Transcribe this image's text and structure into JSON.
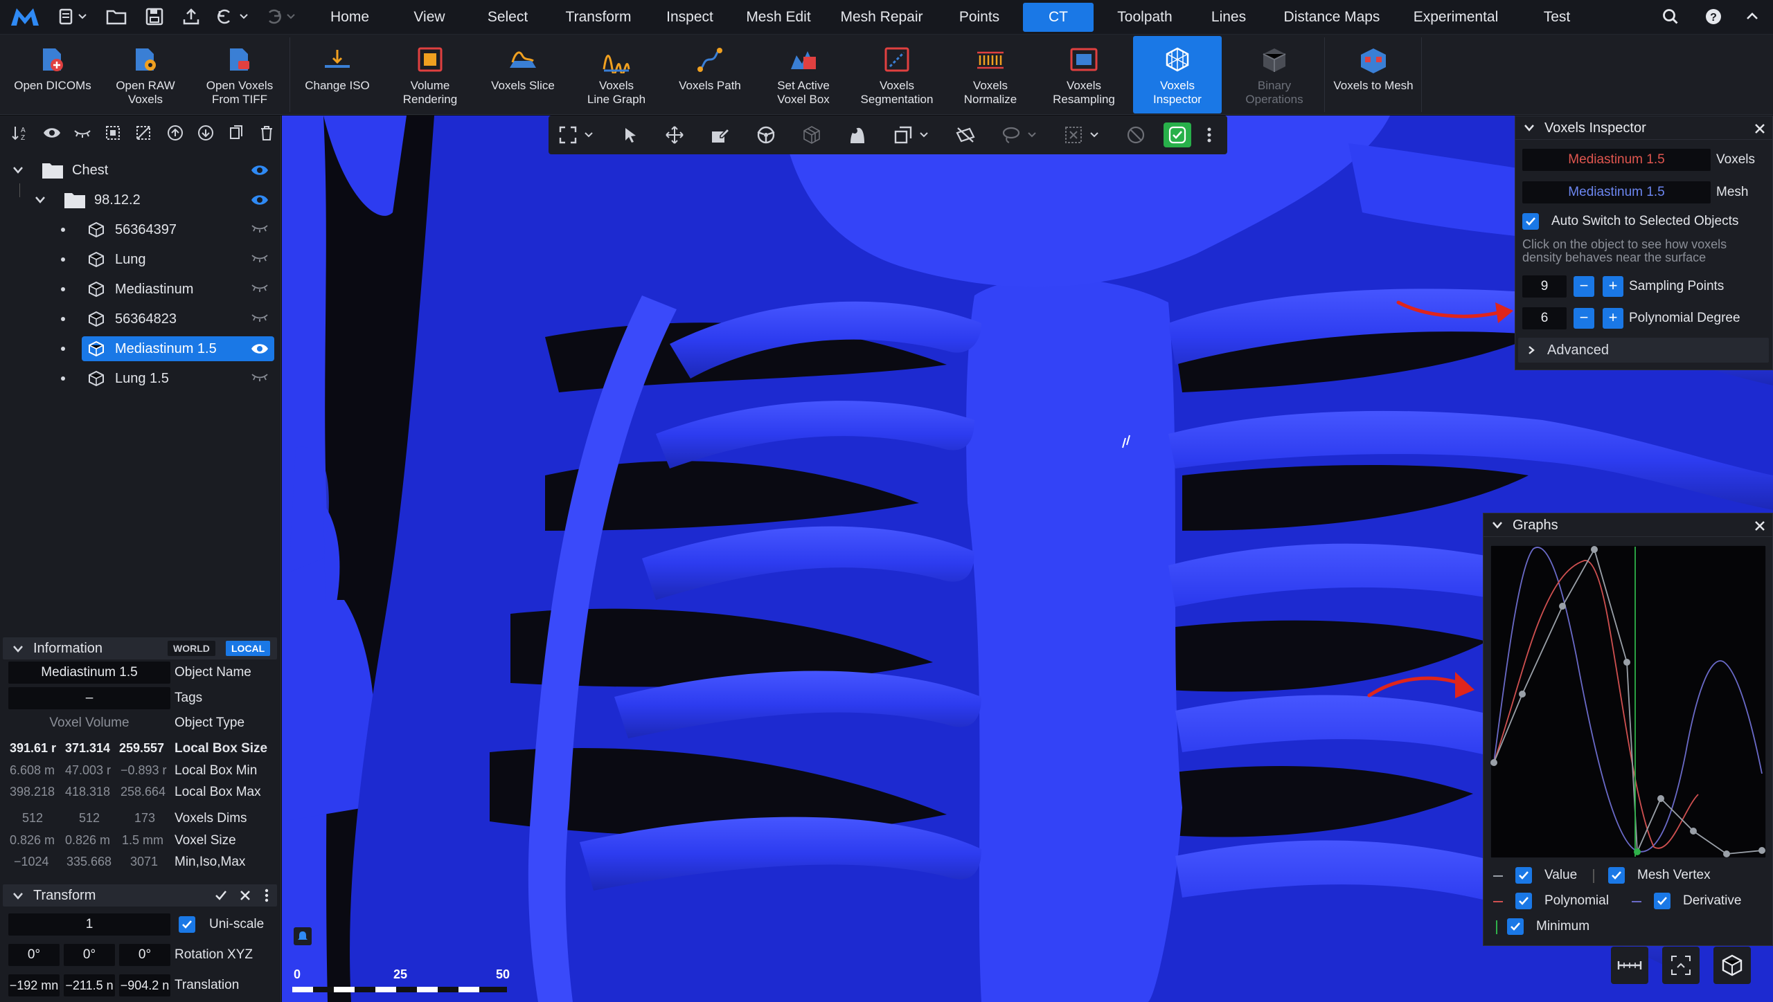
{
  "colors": {
    "accent": "#1a78e6",
    "mesh": "#2d3cf0",
    "highlight_text": "#e0564f",
    "arrow": "#e0251b",
    "value_curve": "#9aa0a8",
    "polynomial_curve": "#d05050",
    "derivative_curve": "#6a6ac8",
    "minimum_line": "#2fb14a"
  },
  "menu": {
    "items": [
      "Home",
      "View",
      "Select",
      "Transform",
      "Inspect",
      "Mesh Edit",
      "Mesh Repair",
      "Points",
      "CT",
      "Toolpath",
      "Lines",
      "Distance Maps",
      "Experimental",
      "Test"
    ],
    "active": "CT"
  },
  "ribbon": {
    "buttons": [
      {
        "label": "Open DICOMs"
      },
      {
        "label": "Open RAW\nVoxels"
      },
      {
        "label": "Open Voxels\nFrom TIFF"
      },
      {
        "label": "Change ISO"
      },
      {
        "label": "Volume\nRendering"
      },
      {
        "label": "Voxels Slice"
      },
      {
        "label": "Voxels\nLine Graph"
      },
      {
        "label": "Voxels Path"
      },
      {
        "label": "Set Active\nVoxel Box"
      },
      {
        "label": "Voxels\nSegmentation"
      },
      {
        "label": "Voxels\nNormalize"
      },
      {
        "label": "Voxels\nResampling"
      },
      {
        "label": "Voxels\nInspector"
      },
      {
        "label": "Binary\nOperations"
      },
      {
        "label": "Voxels to Mesh"
      }
    ]
  },
  "tree": {
    "root": "Chest",
    "group": "98.12.2",
    "items": [
      "56364397",
      "Lung",
      "Mediastinum",
      "56364823",
      "Mediastinum 1.5",
      "Lung 1.5"
    ],
    "selected": "Mediastinum 1.5"
  },
  "information": {
    "title": "Information",
    "world": "WORLD",
    "local": "LOCAL",
    "object_name_value": "Mediastinum 1.5",
    "object_name_label": "Object Name",
    "tags_value": "–",
    "tags_label": "Tags",
    "object_type_value": "Voxel Volume",
    "object_type_label": "Object Type",
    "rows": [
      {
        "values": [
          "391.61 r",
          "371.314",
          "259.557"
        ],
        "label": "Local Box Size"
      },
      {
        "values": [
          "6.608 m",
          "47.003 r",
          "−0.893 r"
        ],
        "label": "Local Box Min"
      },
      {
        "values": [
          "398.218",
          "418.318",
          "258.664"
        ],
        "label": "Local Box Max"
      },
      {
        "values": [
          "512",
          "512",
          "173"
        ],
        "label": "Voxels Dims"
      },
      {
        "values": [
          "0.826 m",
          "0.826 m",
          "1.5 mm"
        ],
        "label": "Voxel Size"
      },
      {
        "values": [
          "−1024",
          "335.668",
          "3071"
        ],
        "label": "Min,Iso,Max"
      }
    ]
  },
  "transform": {
    "title": "Transform",
    "scale_value": "1",
    "uniscale_label": "Uni-scale",
    "rotation": [
      "0°",
      "0°",
      "0°"
    ],
    "rotation_label": "Rotation XYZ",
    "translation": [
      "−192 mn",
      "−211.5 n",
      "−904.2 n"
    ],
    "translation_label": "Translation"
  },
  "inspector": {
    "title": "Voxels Inspector",
    "voxels_value": "Mediastinum 1.5",
    "voxels_label": "Voxels",
    "mesh_value": "Mediastinum 1.5",
    "mesh_label": "Mesh",
    "auto_switch_label": "Auto Switch to Selected Objects",
    "hint": "Click on the object to see how voxels density behaves near the surface",
    "sampling_value": "9",
    "sampling_label": "Sampling Points",
    "poly_value": "6",
    "poly_label": "Polynomial Degree",
    "advanced_label": "Advanced"
  },
  "graphs": {
    "title": "Graphs",
    "legend": [
      "Value",
      "Mesh Vertex",
      "Polynomial",
      "Derivative",
      "Minimum"
    ]
  },
  "scalebar": {
    "ticks": [
      "0",
      "25",
      "50"
    ]
  }
}
